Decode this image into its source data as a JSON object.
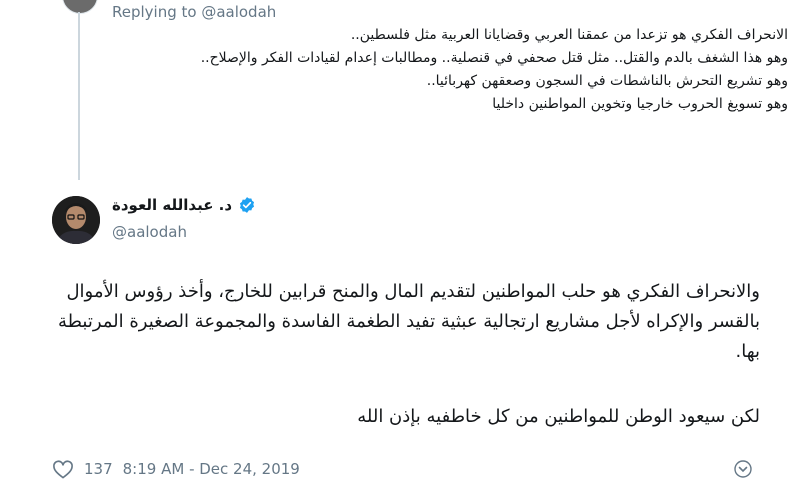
{
  "reply": {
    "label": "Replying to @aalodah",
    "text": "الانحراف الفكري هو تزعدا من عمقنا العربي وقضايانا العربية مثل فلسطين..\nوهو هذا الشغف بالدم والقتل.. مثل قتل صحفي في قنصلية.. ومطالبات إعدام لقيادات الفكر والإصلاح..\nوهو تشريع التحرش بالناشطات في السجون وصعقهن كهربائيا..\nوهو تسويغ الحروب خارجيا وتخوين المواطنين داخليا"
  },
  "author": {
    "display_name": "د. عبدالله العودة",
    "handle": "@aalodah"
  },
  "tweet": {
    "paragraph1": "والانحراف الفكري هو حلب المواطنين لتقديم المال والمنح قرابين للخارج، وأخذ رؤوس الأموال بالقسر والإكراه لأجل مشاريع ارتجالية عبثية تفيد الطغمة الفاسدة والمجموعة الصغيرة المرتبطة بها.",
    "paragraph2": "لكن سيعود الوطن للمواطنين من كل خاطفيه بإذن الله"
  },
  "meta": {
    "likes": "137",
    "time": "8:19 AM - Dec 24, 2019"
  },
  "colors": {
    "verified": "#1da1f2",
    "secondary_text": "#657786",
    "thread_line": "#ccd6dd"
  },
  "icons": [
    "heart-icon",
    "verified-badge-icon",
    "chevron-down-icon"
  ]
}
